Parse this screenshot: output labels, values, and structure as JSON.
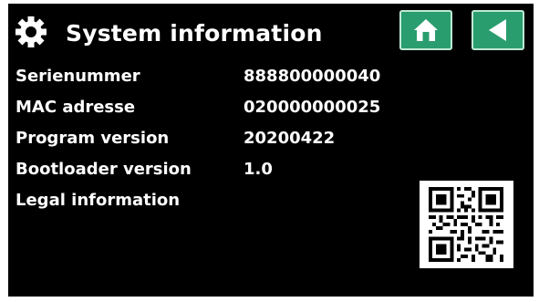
{
  "header": {
    "title": "System information",
    "icons": {
      "settings": "gear-icon",
      "home": "home-icon",
      "back": "back-arrow-icon"
    }
  },
  "info": [
    {
      "label": "Serienummer",
      "value": "888800000040"
    },
    {
      "label": "MAC adresse",
      "value": "020000000025"
    },
    {
      "label": "Program version",
      "value": "20200422"
    },
    {
      "label": "Bootloader version",
      "value": "1.0"
    },
    {
      "label": "Legal information",
      "value": ""
    }
  ],
  "colors": {
    "background": "#000000",
    "text": "#ffffff",
    "button": "#2a9d6e"
  }
}
